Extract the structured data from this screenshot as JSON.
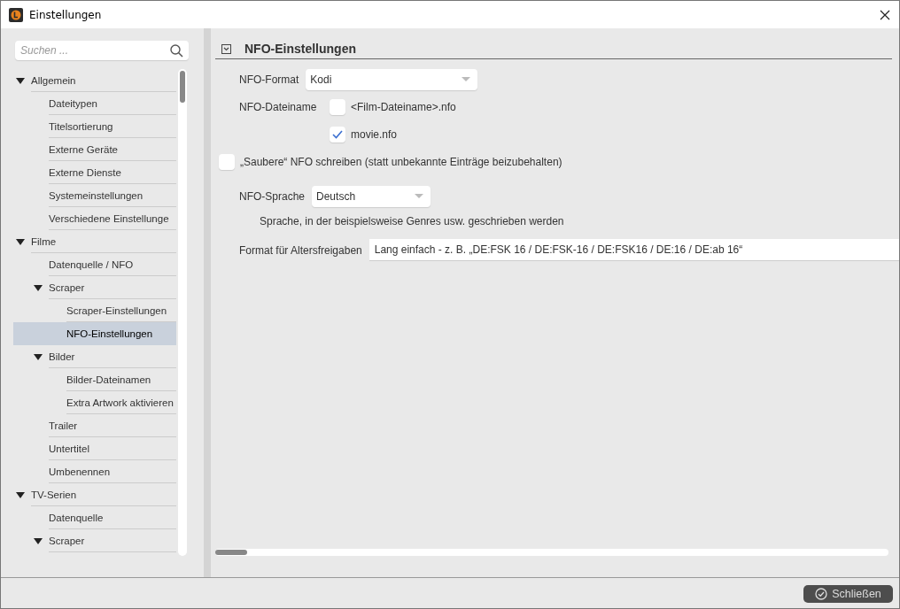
{
  "window": {
    "title": "Einstellungen"
  },
  "search": {
    "placeholder": "Suchen ..."
  },
  "tree": [
    {
      "label": "Allgemein",
      "selected": false,
      "expanded": true,
      "children": [
        {
          "label": "Dateitypen",
          "selected": false
        },
        {
          "label": "Titelsortierung",
          "selected": false
        },
        {
          "label": "Externe Geräte",
          "selected": false
        },
        {
          "label": "Externe Dienste",
          "selected": false
        },
        {
          "label": "Systemeinstellungen",
          "selected": false
        },
        {
          "label": "Verschiedene Einstellunge",
          "selected": false
        }
      ]
    },
    {
      "label": "Filme",
      "selected": false,
      "expanded": true,
      "children": [
        {
          "label": "Datenquelle / NFO",
          "selected": false
        },
        {
          "label": "Scraper",
          "selected": false,
          "expanded": true,
          "children": [
            {
              "label": "Scraper-Einstellungen",
              "selected": false
            },
            {
              "label": "NFO-Einstellungen",
              "selected": true
            }
          ]
        },
        {
          "label": "Bilder",
          "selected": false,
          "expanded": true,
          "children": [
            {
              "label": "Bilder-Dateinamen",
              "selected": false
            },
            {
              "label": "Extra Artwork aktivieren",
              "selected": false
            }
          ]
        },
        {
          "label": "Trailer",
          "selected": false
        },
        {
          "label": "Untertitel",
          "selected": false
        },
        {
          "label": "Umbenennen",
          "selected": false
        }
      ]
    },
    {
      "label": "TV-Serien",
      "selected": false,
      "expanded": true,
      "children": [
        {
          "label": "Datenquelle",
          "selected": false
        },
        {
          "label": "Scraper",
          "selected": false,
          "expanded": true
        }
      ]
    }
  ],
  "section": {
    "title": "NFO-Einstellungen",
    "expanded": true
  },
  "nfo_format": {
    "label": "NFO-Format",
    "value": "Kodi"
  },
  "nfo_filename": {
    "label": "NFO-Dateiname",
    "options": [
      {
        "label": "<Film-Dateiname>.nfo",
        "checked": false
      },
      {
        "label": "movie.nfo",
        "checked": true
      }
    ]
  },
  "clean_nfo": {
    "label": "„Saubere“ NFO schreiben (statt unbekannte Einträge beizubehalten)",
    "checked": false
  },
  "nfo_language": {
    "label": "NFO-Sprache",
    "value": "Deutsch",
    "hint": "Sprache, in der beispielsweise Genres usw. geschrieben werden"
  },
  "rating_format": {
    "label": "Format für Altersfreigaben",
    "value": "Lang einfach - z. B. „DE:FSK 16 / DE:FSK-16 / DE:FSK16 / DE:16 / DE:ab 16“"
  },
  "close_button": {
    "label": "Schließen"
  }
}
